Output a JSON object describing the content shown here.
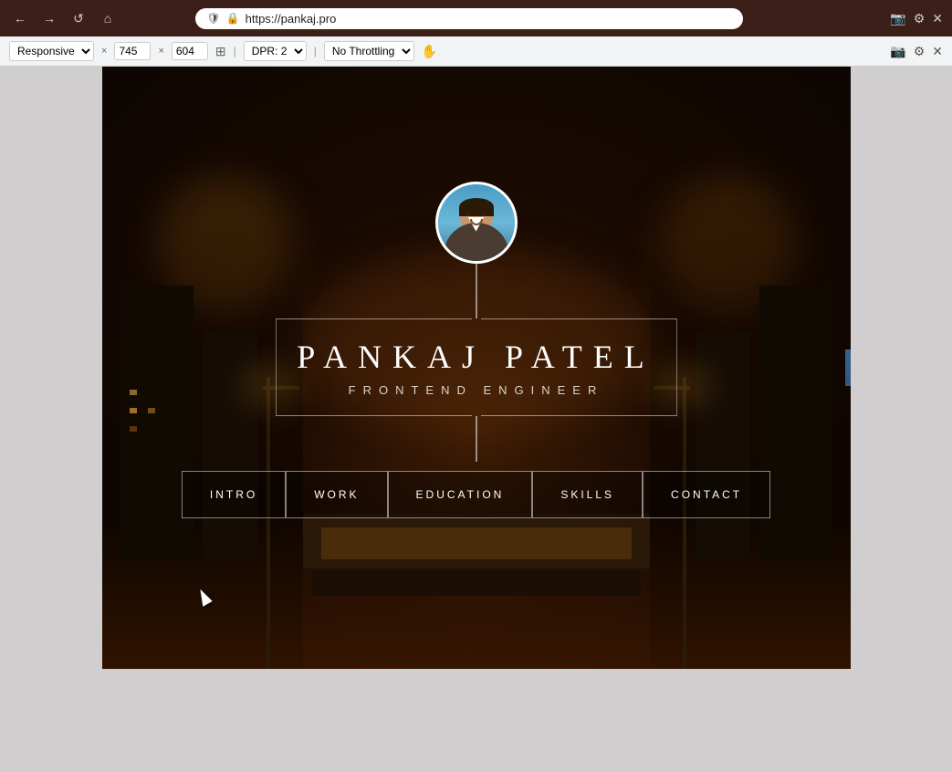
{
  "browser": {
    "url": "https://pankaj.pro",
    "nav_back": "←",
    "nav_forward": "→",
    "nav_refresh": "↺",
    "nav_home": "⌂",
    "responsive_label": "Responsive",
    "width_value": "745",
    "height_value": "604",
    "dpr_label": "DPR: 2",
    "throttle_label": "No Throttling",
    "screenshot_icon": "📷",
    "settings_icon": "⚙",
    "close_icon": "✕"
  },
  "site": {
    "name": "PANKAJ PATEL",
    "title": "FRONTEND ENGINEER",
    "accent_color": "#4a90d9",
    "nav": [
      {
        "label": "INTRO"
      },
      {
        "label": "WORK"
      },
      {
        "label": "EDUCATION"
      },
      {
        "label": "SKILLS"
      },
      {
        "label": "CONTACT"
      }
    ]
  }
}
